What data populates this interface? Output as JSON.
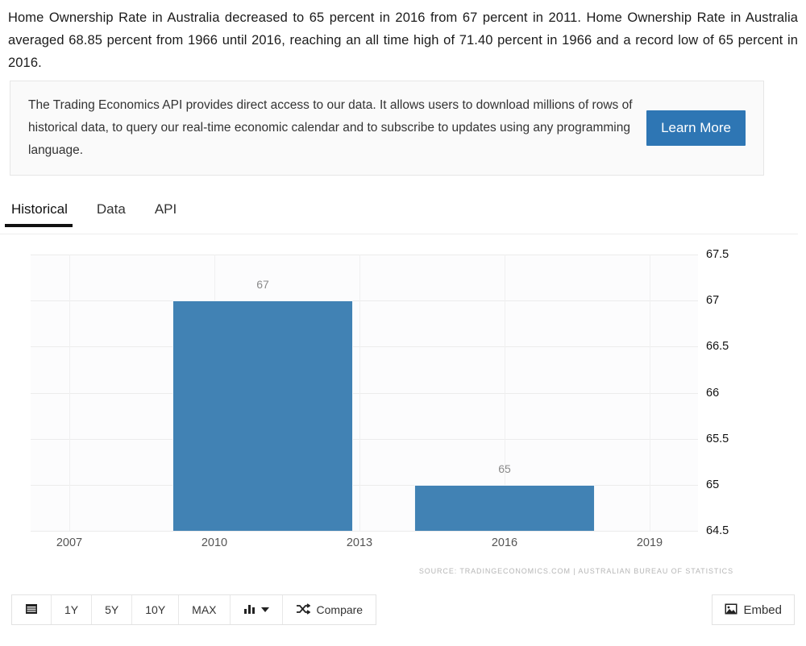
{
  "intro": {
    "text": "Home Ownership Rate in Australia decreased to 65 percent in 2016 from 67 percent in 2011. Home Ownership Rate in Australia averaged 68.85 percent from 1966 until 2016, reaching an all time high of 71.40 percent in 1966 and a record low of 65 percent in 2016."
  },
  "api_banner": {
    "text": "The Trading Economics API provides direct access to our data. It allows users to download millions of rows of historical data, to query our real-time economic calendar and to subscribe to updates using any programming language.",
    "button_label": "Learn More",
    "button_color": "#2e76b4"
  },
  "tabs": [
    {
      "label": "Historical",
      "active": true
    },
    {
      "label": "Data",
      "active": false
    },
    {
      "label": "API",
      "active": false
    }
  ],
  "chart_data": {
    "type": "bar",
    "title": "",
    "xlabel": "",
    "ylabel": "",
    "categories": [
      "2011",
      "2016"
    ],
    "values": [
      67,
      65
    ],
    "bar_labels": [
      "67",
      "65"
    ],
    "bar_color": "#4182b4",
    "ylim": [
      64.5,
      67.5
    ],
    "yticks": [
      "67.5",
      "67",
      "66.5",
      "66",
      "65.5",
      "65",
      "64.5"
    ],
    "ytick_values": [
      67.5,
      67,
      66.5,
      66,
      65.5,
      65,
      64.5
    ],
    "xticks": [
      "2007",
      "2010",
      "2013",
      "2016",
      "2019"
    ],
    "xtick_values": [
      2007,
      2010,
      2013,
      2016,
      2019
    ],
    "grid": true,
    "legend": "none",
    "source": "SOURCE: TRADINGECONOMICS.COM | AUSTRALIAN BUREAU OF STATISTICS"
  },
  "toolbar": {
    "calendar_icon": "calendar-icon",
    "ranges": [
      "1Y",
      "5Y",
      "10Y",
      "MAX"
    ],
    "chart_type_icon": "bar-chart-icon",
    "compare_icon": "shuffle-icon",
    "compare_label": "Compare",
    "embed_icon": "image-icon",
    "embed_label": "Embed"
  }
}
